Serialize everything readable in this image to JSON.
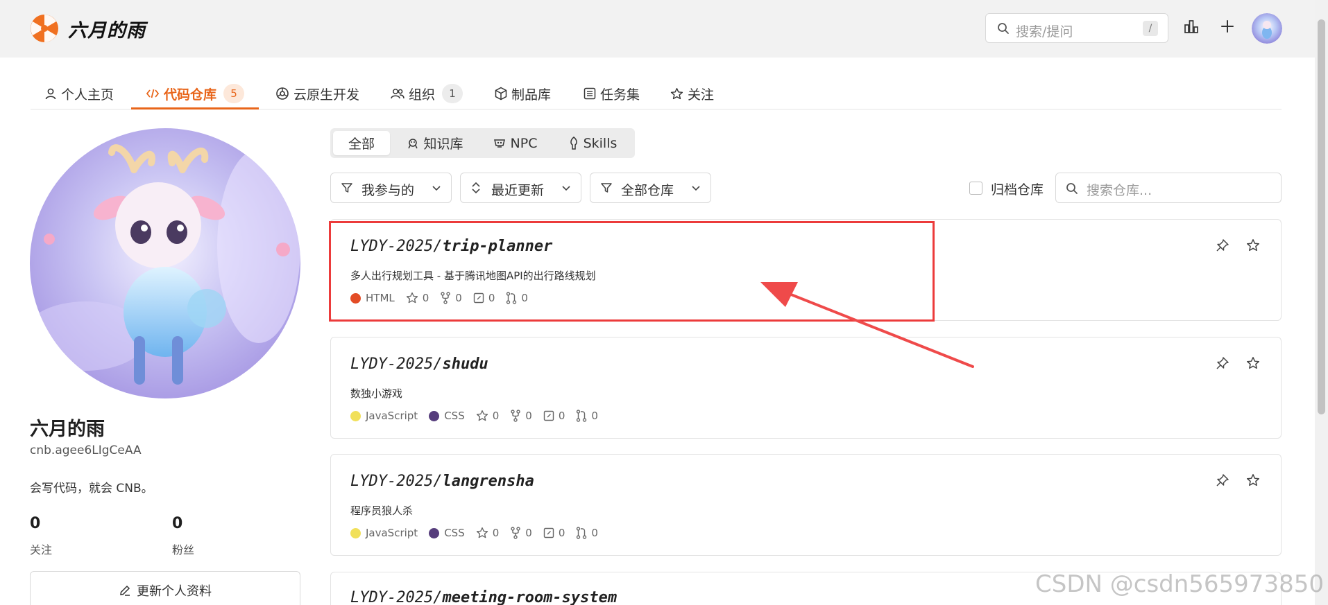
{
  "header": {
    "brand": "六月的雨",
    "search_placeholder": "搜索/提问",
    "search_shortcut": "/"
  },
  "tabs": [
    {
      "label": "个人主页",
      "icon": "user-icon"
    },
    {
      "label": "代码仓库",
      "icon": "code-icon",
      "count": "5",
      "active": true
    },
    {
      "label": "云原生开发",
      "icon": "cloud-native-icon"
    },
    {
      "label": "组织",
      "icon": "group-icon",
      "count": "1"
    },
    {
      "label": "制品库",
      "icon": "package-icon"
    },
    {
      "label": "任务集",
      "icon": "tasks-icon"
    },
    {
      "label": "关注",
      "icon": "star-icon"
    }
  ],
  "profile": {
    "name": "六月的雨",
    "id": "cnb.agee6LIgCeAA",
    "bio": "会写代码，就会 CNB。",
    "following_count": "0",
    "following_label": "关注",
    "followers_count": "0",
    "followers_label": "粉丝",
    "edit_label": "更新个人资料"
  },
  "segments": [
    {
      "label": "全部",
      "active": true
    },
    {
      "label": "知识库",
      "icon": "knowledge-icon"
    },
    {
      "label": "NPC",
      "icon": "npc-icon"
    },
    {
      "label": "Skills",
      "icon": "skills-icon"
    }
  ],
  "filters": {
    "participation": "我参与的",
    "sort": "最近更新",
    "type": "全部仓库",
    "archive_label": "归档仓库",
    "search_placeholder": "搜索仓库..."
  },
  "repos": [
    {
      "owner": "LYDY-2025/",
      "name": "trip-planner",
      "desc": "多人出行规划工具 - 基于腾讯地图API的出行路线规划",
      "langs": [
        {
          "name": "HTML",
          "color": "#e34c26"
        }
      ],
      "stars": "0",
      "forks": "0",
      "issues": "0",
      "prs": "0"
    },
    {
      "owner": "LYDY-2025/",
      "name": "shudu",
      "desc": "数独小游戏",
      "langs": [
        {
          "name": "JavaScript",
          "color": "#f1e05a"
        },
        {
          "name": "CSS",
          "color": "#563d7c"
        }
      ],
      "stars": "0",
      "forks": "0",
      "issues": "0",
      "prs": "0"
    },
    {
      "owner": "LYDY-2025/",
      "name": "langrensha",
      "desc": "程序员狼人杀",
      "langs": [
        {
          "name": "JavaScript",
          "color": "#f1e05a"
        },
        {
          "name": "CSS",
          "color": "#563d7c"
        }
      ],
      "stars": "0",
      "forks": "0",
      "issues": "0",
      "prs": "0"
    },
    {
      "owner": "LYDY-2025/",
      "name": "meeting-room-system"
    }
  ],
  "watermark": "CSDN @csdn565973850",
  "colors": {
    "accent": "#e8651a",
    "highlight": "#ec3b3b"
  }
}
